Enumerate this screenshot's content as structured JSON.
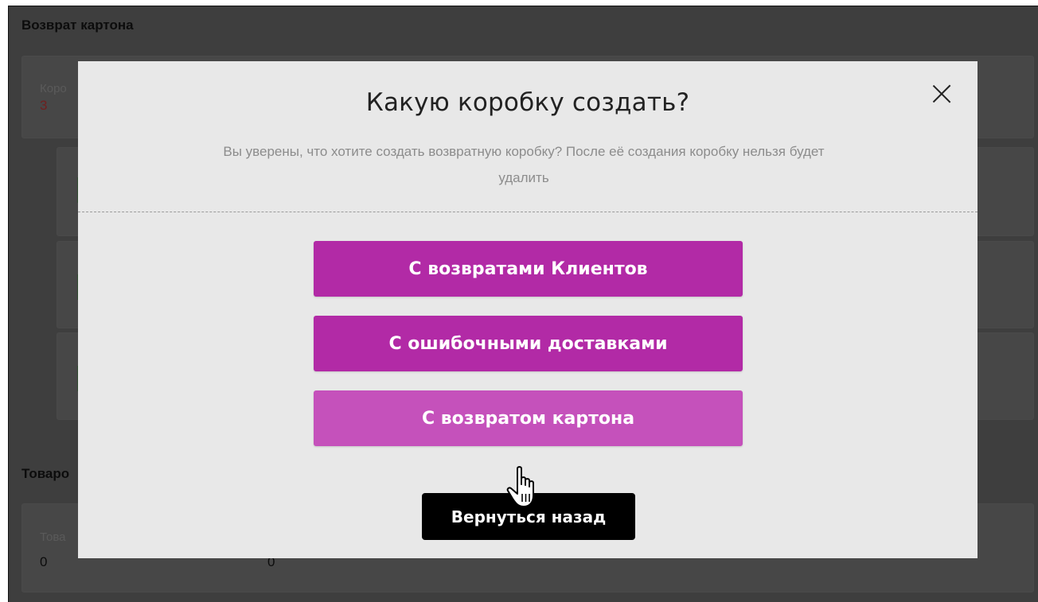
{
  "background": {
    "section_title": "Возврат картона",
    "card1": {
      "label": "Коро",
      "value": "3"
    },
    "section2_title": "Товаро",
    "card2": {
      "label": "Това",
      "value": "0",
      "value2": "0"
    }
  },
  "modal": {
    "title": "Какую коробку создать?",
    "description_line1": "Вы уверены, что хотите создать возвратную коробку? После её создания коробку нельзя будет",
    "description_line2": "удалить",
    "options": [
      {
        "label": "С возвратами Клиентов"
      },
      {
        "label": "С ошибочными доставками"
      },
      {
        "label": "С возвратом картона"
      }
    ],
    "back_label": "Вернуться назад",
    "close_icon": "close-icon"
  },
  "colors": {
    "accent": "#b22aa6",
    "accent_hover": "#c551bb",
    "overlay": "#3e3e3e",
    "modal_bg": "#e8e8e8",
    "back_button": "#000000"
  },
  "cursor_icon": "hand-pointer-icon"
}
